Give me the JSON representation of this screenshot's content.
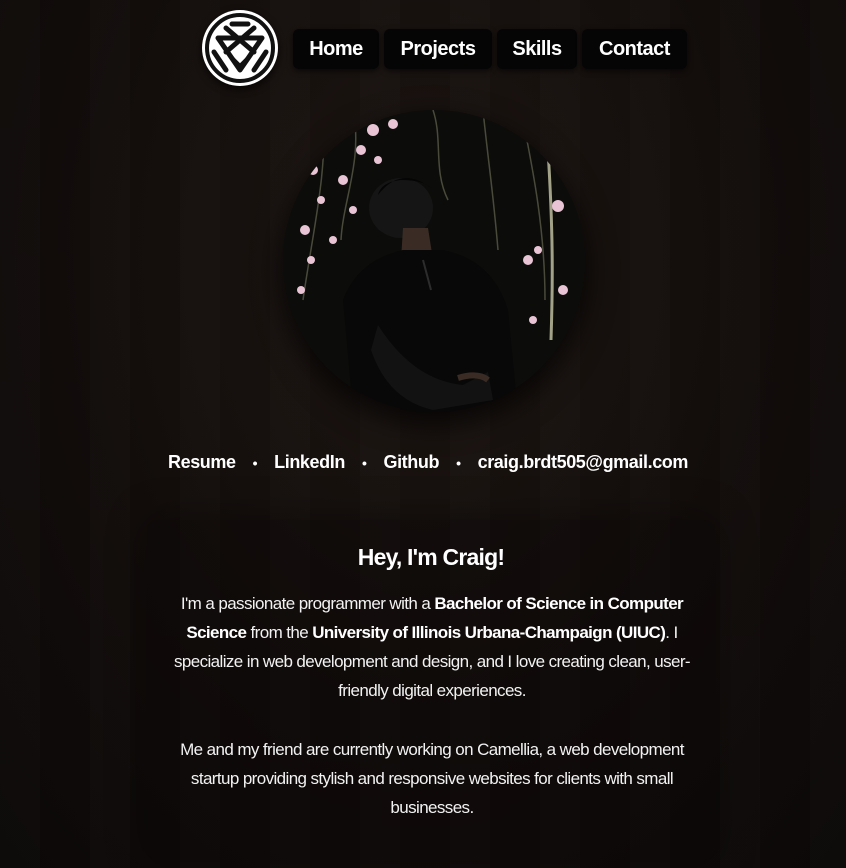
{
  "nav": {
    "items": [
      {
        "label": "Home"
      },
      {
        "label": "Projects"
      },
      {
        "label": "Skills"
      },
      {
        "label": "Contact"
      }
    ]
  },
  "links": {
    "resume": "Resume",
    "linkedin": "LinkedIn",
    "github": "Github",
    "email": "craig.brdt505@gmail.com",
    "separator": "•"
  },
  "intro": {
    "heading": "Hey, I'm Craig!",
    "p1": {
      "t1": "I'm a passionate programmer with a ",
      "b1": "Bachelor of Science in Computer Science",
      "t2": " from the ",
      "b2": "University of Illinois Urbana-Champaign (UIUC)",
      "t3": ". I specialize in web development and design, and I love creating clean, user-friendly digital experiences."
    },
    "p2": "Me and my friend are currently working on Camellia, a web development startup providing stylish and responsive websites for clients with small businesses."
  },
  "icons": {
    "logo": "geometric-face-logo-icon",
    "profile": "profile-photo"
  }
}
